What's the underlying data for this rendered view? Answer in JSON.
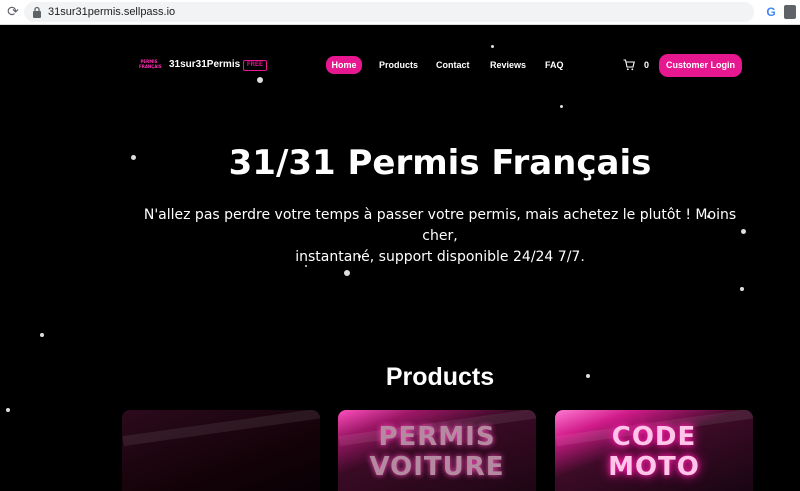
{
  "browser": {
    "url": "31sur31permis.sellpass.io"
  },
  "nav": {
    "logo_lines": [
      "PERMIS",
      "FRANÇAIS"
    ],
    "site_name": "31sur31Permis",
    "badge": "FREE",
    "items": [
      {
        "label": "Home",
        "active": true
      },
      {
        "label": "Products",
        "active": false
      },
      {
        "label": "Contact",
        "active": false
      },
      {
        "label": "Reviews",
        "active": false
      },
      {
        "label": "FAQ",
        "active": false
      }
    ],
    "cart_count": "0",
    "login_label": "Customer Login"
  },
  "hero": {
    "title": "31/31 Permis Français",
    "subtitle_line1": "N'allez pas perdre votre temps à passer votre permis, mais achetez le plutôt ! Moins cher,",
    "subtitle_line2": "instantané, support disponible 24/24 7/7."
  },
  "products": {
    "title": "Products",
    "cards": [
      {
        "lines": []
      },
      {
        "lines": [
          "PERMIS",
          "VOITURE"
        ]
      },
      {
        "lines": [
          "CODE",
          "MOTO"
        ]
      }
    ]
  },
  "colors": {
    "accent": "#e6178f",
    "background": "#000000"
  },
  "icons": [
    "reload-icon",
    "lock-icon",
    "google-icon",
    "translate-icon",
    "cart-icon"
  ]
}
